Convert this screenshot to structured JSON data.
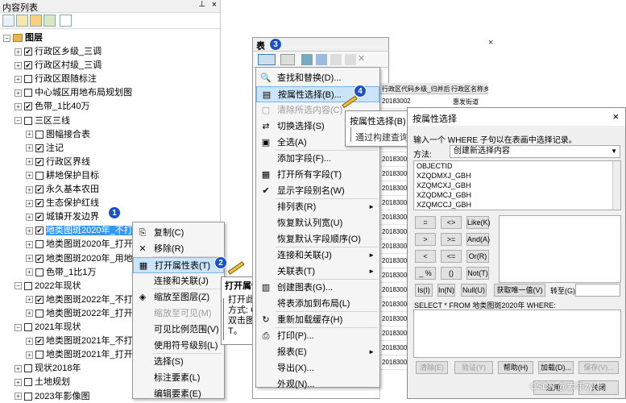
{
  "toc": {
    "title": "内容列表",
    "pin": "⊥",
    "close": "×",
    "root": "图层",
    "layers": [
      {
        "label": "行政区乡级_三调",
        "indent": 1,
        "expand": "+",
        "check": true
      },
      {
        "label": "行政区村级_三调",
        "indent": 1,
        "expand": "+",
        "check": true
      },
      {
        "label": "行政区跟随标注",
        "indent": 1,
        "expand": "+",
        "check": false
      },
      {
        "label": "中心城区用地布局规划图",
        "indent": 1,
        "expand": "+",
        "check": false
      },
      {
        "label": "色带_1比40万",
        "indent": 1,
        "expand": "+",
        "check": true
      },
      {
        "label": "三区三线",
        "indent": 1,
        "expand": "−",
        "check": false
      },
      {
        "label": "图幅接合表",
        "indent": 2,
        "expand": "+",
        "check": false
      },
      {
        "label": "注记",
        "indent": 2,
        "expand": "+",
        "check": true
      },
      {
        "label": "行政区界线",
        "indent": 2,
        "expand": "+",
        "check": true
      },
      {
        "label": "耕地保护目标",
        "indent": 2,
        "expand": "+",
        "check": false
      },
      {
        "label": "永久基本农田",
        "indent": 2,
        "expand": "+",
        "check": true
      },
      {
        "label": "生态保护红线",
        "indent": 2,
        "expand": "+",
        "check": true
      },
      {
        "label": "城镇开发边界",
        "indent": 2,
        "expand": "+",
        "check": true
      },
      {
        "label": "地类图斑2020年_不打开",
        "indent": 2,
        "expand": "+",
        "check": true,
        "selected": true
      },
      {
        "label": "地类图斑2020年_打开",
        "indent": 2,
        "expand": "+",
        "check": false
      },
      {
        "label": "地类图斑2020年_用地",
        "indent": 2,
        "expand": "+",
        "check": true
      },
      {
        "label": "色带_1比1万",
        "indent": 2,
        "expand": "+",
        "check": false
      },
      {
        "label": "2022年现状",
        "indent": 1,
        "expand": "−",
        "check": false
      },
      {
        "label": "地类图斑2022年_不打开",
        "indent": 2,
        "expand": "+",
        "check": true
      },
      {
        "label": "地类图斑2022年_打开",
        "indent": 2,
        "expand": "+",
        "check": false
      },
      {
        "label": "2021年现状",
        "indent": 1,
        "expand": "−",
        "check": false
      },
      {
        "label": "地类图斑2021年_不打开",
        "indent": 2,
        "expand": "+",
        "check": true
      },
      {
        "label": "地类图斑2021年_打开",
        "indent": 2,
        "expand": "+",
        "check": false
      },
      {
        "label": "现状2018年",
        "indent": 1,
        "expand": "+",
        "check": false
      },
      {
        "label": "土地规划",
        "indent": 1,
        "expand": "+",
        "check": false
      },
      {
        "label": "2023年影像图",
        "indent": 1,
        "expand": "+",
        "check": false
      }
    ]
  },
  "badges": {
    "b1": "1",
    "b2": "2",
    "b3": "3",
    "b4": "4"
  },
  "layer_menu": [
    {
      "label": "复制(C)",
      "icon": "copy-icon",
      "glyph": "⎘",
      "sep_after": false
    },
    {
      "label": "移除(R)",
      "icon": "remove-icon",
      "glyph": "✕",
      "sep_after": true
    },
    {
      "label": "打开属性表(T)",
      "icon": "table-icon",
      "glyph": "▦",
      "highlight": true,
      "sep_after": false
    },
    {
      "label": "连接和关联(J)",
      "icon": "",
      "glyph": "",
      "sep_after": true
    },
    {
      "label": "缩放至图层(Z)",
      "icon": "zoom-layer-icon",
      "glyph": "◈",
      "sep_after": false
    },
    {
      "label": "缩放至可见(M)",
      "icon": "",
      "glyph": "",
      "disabled": true,
      "sep_after": false
    },
    {
      "label": "可见比例范围(V)",
      "icon": "",
      "glyph": "",
      "sep_after": false
    },
    {
      "label": "使用符号级别(L)",
      "icon": "",
      "glyph": "",
      "sep_after": true
    },
    {
      "label": "选择(S)",
      "icon": "",
      "glyph": "",
      "sep_after": false
    },
    {
      "label": "标注要素(L)",
      "icon": "",
      "glyph": "",
      "sep_after": false
    },
    {
      "label": "编辑要素(E)",
      "icon": "",
      "glyph": "",
      "sep_after": false
    }
  ],
  "tip_small": {
    "title": "打开属性",
    "lines": [
      "打开此",
      "方式: C",
      "双击图",
      "T。"
    ]
  },
  "table": {
    "title": "表",
    "close": "×",
    "headers": [
      "行政区代码乡级_归并后",
      "行政区名称乡级"
    ],
    "rows": [
      "20183002",
      "20183002",
      "20183002",
      "20183002",
      "20183002",
      "20183002",
      "20183002",
      "20183002",
      "20183002",
      "20183002",
      "20183002",
      "20183002",
      "20183002",
      "20183002",
      "20183002",
      "20183002",
      "20183002",
      "20183002",
      "20183002"
    ],
    "names": [
      "惠发街道",
      "惠发街道"
    ]
  },
  "table_menu": [
    {
      "label": "查找和替换(D)...",
      "glyph": "🔍",
      "sep_after": false
    },
    {
      "label": "按属性选择(B)...",
      "glyph": "▤",
      "highlight": true,
      "sep_after": false
    },
    {
      "label": "清除所选内容(C)",
      "glyph": "▢",
      "disabled": true,
      "sep_after": false
    },
    {
      "label": "切换选择(S)",
      "glyph": "⇄",
      "sep_after": false
    },
    {
      "label": "全选(A)",
      "glyph": "▣",
      "sep_after": true
    },
    {
      "label": "添加字段(F)...",
      "glyph": "",
      "sep_after": false
    },
    {
      "label": "打开所有字段(T)",
      "glyph": "▦",
      "sep_after": false
    },
    {
      "label": "显示字段别名(W)",
      "glyph": "✔",
      "sep_after": true
    },
    {
      "label": "排列表(R)",
      "glyph": "",
      "arrow": true,
      "sep_after": false
    },
    {
      "label": "恢复默认列宽(U)",
      "glyph": "",
      "sep_after": false
    },
    {
      "label": "恢复默认字段顺序(O)",
      "glyph": "",
      "sep_after": true
    },
    {
      "label": "连接和关联(J)",
      "glyph": "",
      "arrow": true,
      "sep_after": false
    },
    {
      "label": "关联表(T)",
      "glyph": "",
      "arrow": true,
      "sep_after": true
    },
    {
      "label": "创建图表(G)...",
      "glyph": "▥",
      "sep_after": false
    },
    {
      "label": "将表添加到布局(L)",
      "glyph": "",
      "sep_after": true
    },
    {
      "label": "重新加载缓存(H)",
      "glyph": "↻",
      "sep_after": true
    },
    {
      "label": "打印(P)...",
      "glyph": "⎙",
      "sep_after": false
    },
    {
      "label": "报表(E)",
      "glyph": "",
      "arrow": true,
      "sep_after": false
    },
    {
      "label": "导出(X)...",
      "glyph": "",
      "sep_after": false
    },
    {
      "label": "外观(N)...",
      "glyph": "",
      "sep_after": false
    }
  ],
  "tooltip": {
    "title": "按属性选择(B)",
    "desc": "通过构建查询"
  },
  "dialog": {
    "title": "按属性选择",
    "close": "×",
    "intro": "输入一个 WHERE 子句以在表画中选择记录。",
    "method_label": "方法:",
    "method_value": "创建新选择内容",
    "fields": [
      "OBJECTID",
      "XZQDMXJ_GBH",
      "XZQMCXJ_GBH",
      "XZQDMCJ_GBH",
      "XZQMCCJ_GBH"
    ],
    "ops": [
      "=",
      "<>",
      "Like(K)",
      ">",
      ">=",
      "And(A)",
      "<",
      "<=",
      "Or(R)",
      "_ %",
      "()",
      "Not(T)"
    ],
    "is_btn": "Is(I)",
    "in_btn": "In(N)",
    "null_btn": "Null(U)",
    "unique_btn": "获取唯一值(V)",
    "goto_label": "转至(G):",
    "sql_prefix": "SELECT * FROM 地类图斑2020年 WHERE:",
    "bottom": {
      "clear": "清除(E)",
      "verify": "验证(Y)",
      "help": "帮助(H)",
      "load": "加载(D)...",
      "save": "保存(V)..."
    },
    "apply": "应用",
    "close_btn": "关闭"
  },
  "watermark": "CSDN @素年zyj"
}
